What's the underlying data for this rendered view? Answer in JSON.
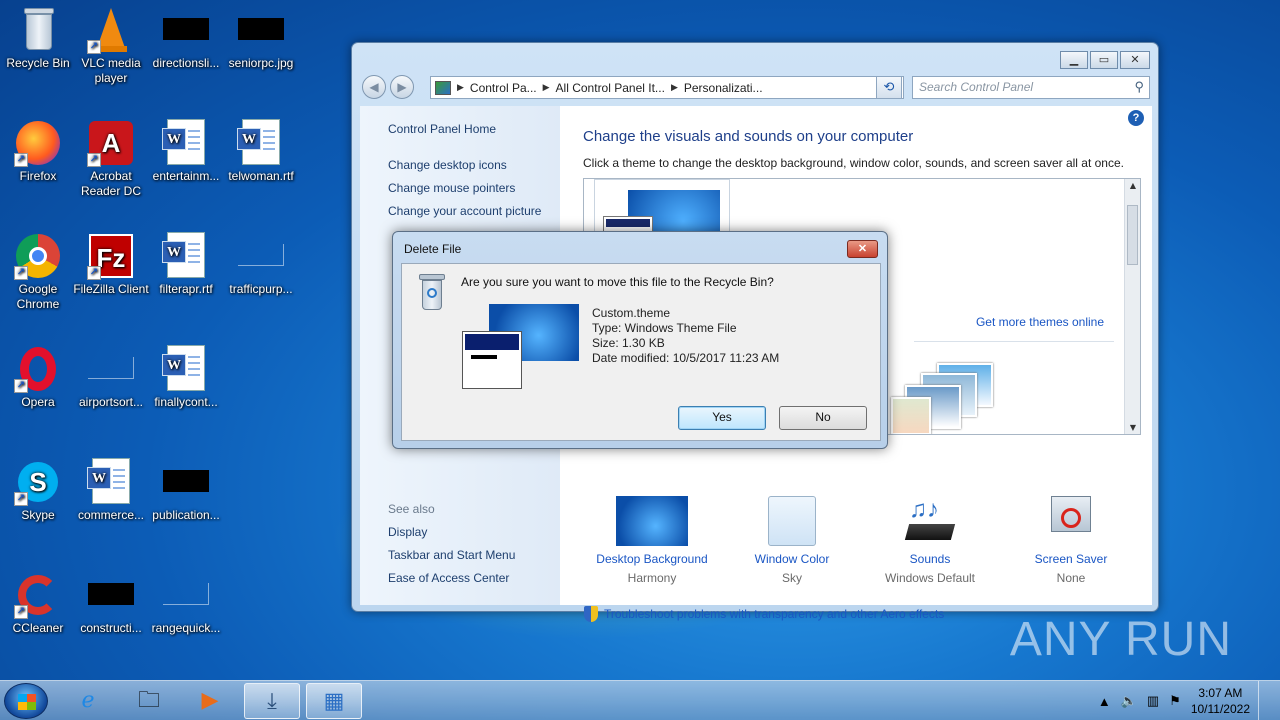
{
  "desktop": {
    "icons": [
      {
        "label": "Recycle Bin"
      },
      {
        "label": "VLC media player"
      },
      {
        "label": "directionsli..."
      },
      {
        "label": "seniorpc.jpg"
      },
      {
        "label": "Firefox"
      },
      {
        "label": "Acrobat Reader DC"
      },
      {
        "label": "entertainm..."
      },
      {
        "label": "telwoman.rtf"
      },
      {
        "label": "Google Chrome"
      },
      {
        "label": "FileZilla Client"
      },
      {
        "label": "filterapr.rtf"
      },
      {
        "label": "trafficpurp..."
      },
      {
        "label": "Opera"
      },
      {
        "label": "airportsort..."
      },
      {
        "label": "finallycont..."
      },
      {
        "label": "Skype"
      },
      {
        "label": "commerce..."
      },
      {
        "label": "publication..."
      },
      {
        "label": "CCleaner"
      },
      {
        "label": "constructi..."
      },
      {
        "label": "rangequick..."
      }
    ]
  },
  "window": {
    "breadcrumb": [
      "Control Pa...",
      "All Control Panel It...",
      "Personalizati..."
    ],
    "search_placeholder": "Search Control Panel",
    "sidebar": {
      "home": "Control Panel Home",
      "links": [
        "Change desktop icons",
        "Change mouse pointers",
        "Change your account picture"
      ],
      "see_also": "See also",
      "see_also_links": [
        "Display",
        "Taskbar and Start Menu",
        "Ease of Access Center"
      ]
    },
    "main": {
      "title": "Change the visuals and sounds on your computer",
      "subtitle": "Click a theme to change the desktop background, window color, sounds, and screen saver all at once.",
      "get_more": "Get more themes online",
      "bottom_items": [
        {
          "label": "Desktop Background",
          "value": "Harmony"
        },
        {
          "label": "Window Color",
          "value": "Sky"
        },
        {
          "label": "Sounds",
          "value": "Windows Default"
        },
        {
          "label": "Screen Saver",
          "value": "None"
        }
      ],
      "troubleshoot": "Troubleshoot problems with transparency and other Aero effects"
    }
  },
  "dialog": {
    "title": "Delete File",
    "question": "Are you sure you want to move this file to the Recycle Bin?",
    "file_name": "Custom.theme",
    "file_type": "Type: Windows Theme File",
    "file_size": "Size: 1.30 KB",
    "file_date": "Date modified: 10/5/2017 11:23 AM",
    "yes": "Yes",
    "no": "No"
  },
  "taskbar": {
    "time": "3:07 AM",
    "date": "10/11/2022"
  },
  "watermark": "ANY RUN"
}
